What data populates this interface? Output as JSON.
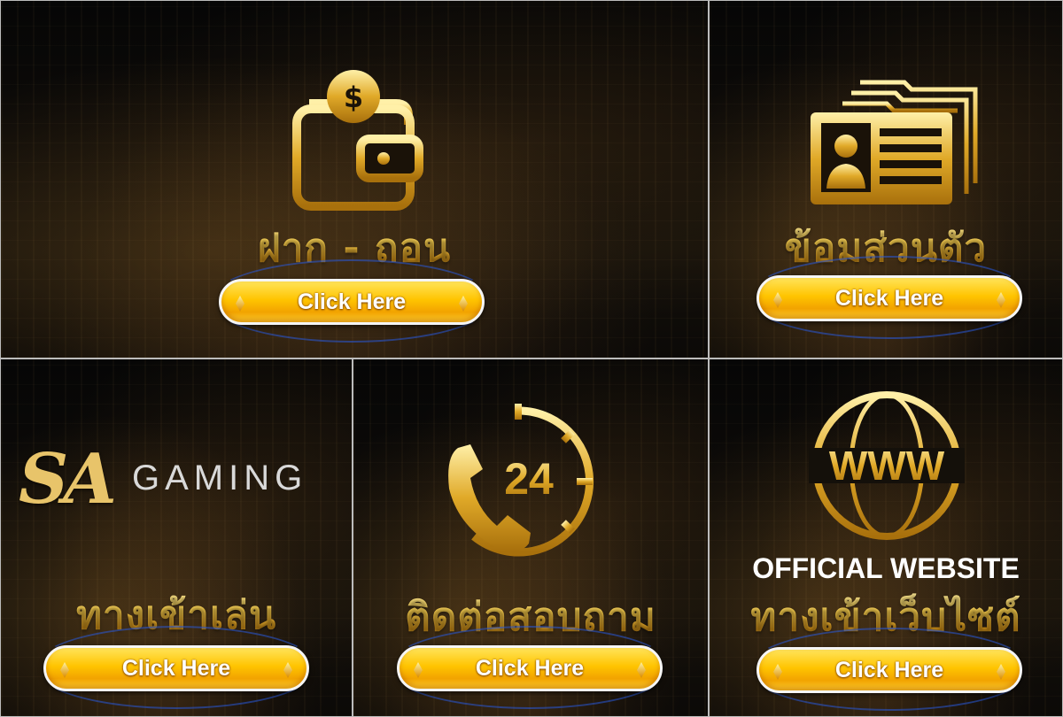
{
  "tiles": [
    {
      "id": "deposit",
      "title": "ฝาก - ถอน",
      "icon": "wallet-dollar-icon",
      "button": "Click Here"
    },
    {
      "id": "profile",
      "title": "ข้อมส่วนตัว",
      "icon": "id-card-icon",
      "button": "Click Here"
    },
    {
      "id": "play",
      "logo_script": "SA",
      "logo_text": "GAMING",
      "title": "ทางเข้าเล่น",
      "button": "Click Here"
    },
    {
      "id": "contact",
      "icon_text": "24",
      "icon": "phone-24-hour-icon",
      "title": "ติดต่อสอบถาม",
      "button": "Click Here"
    },
    {
      "id": "website",
      "icon_text": "WWW",
      "icon": "globe-www-icon",
      "subtitle": "OFFICIAL WEBSITE",
      "title": "ทางเข้าเว็บไซต์",
      "button": "Click Here"
    }
  ],
  "colors": {
    "gold": "#f2c94c",
    "button": "#ffc400",
    "background": "#0b0907"
  }
}
